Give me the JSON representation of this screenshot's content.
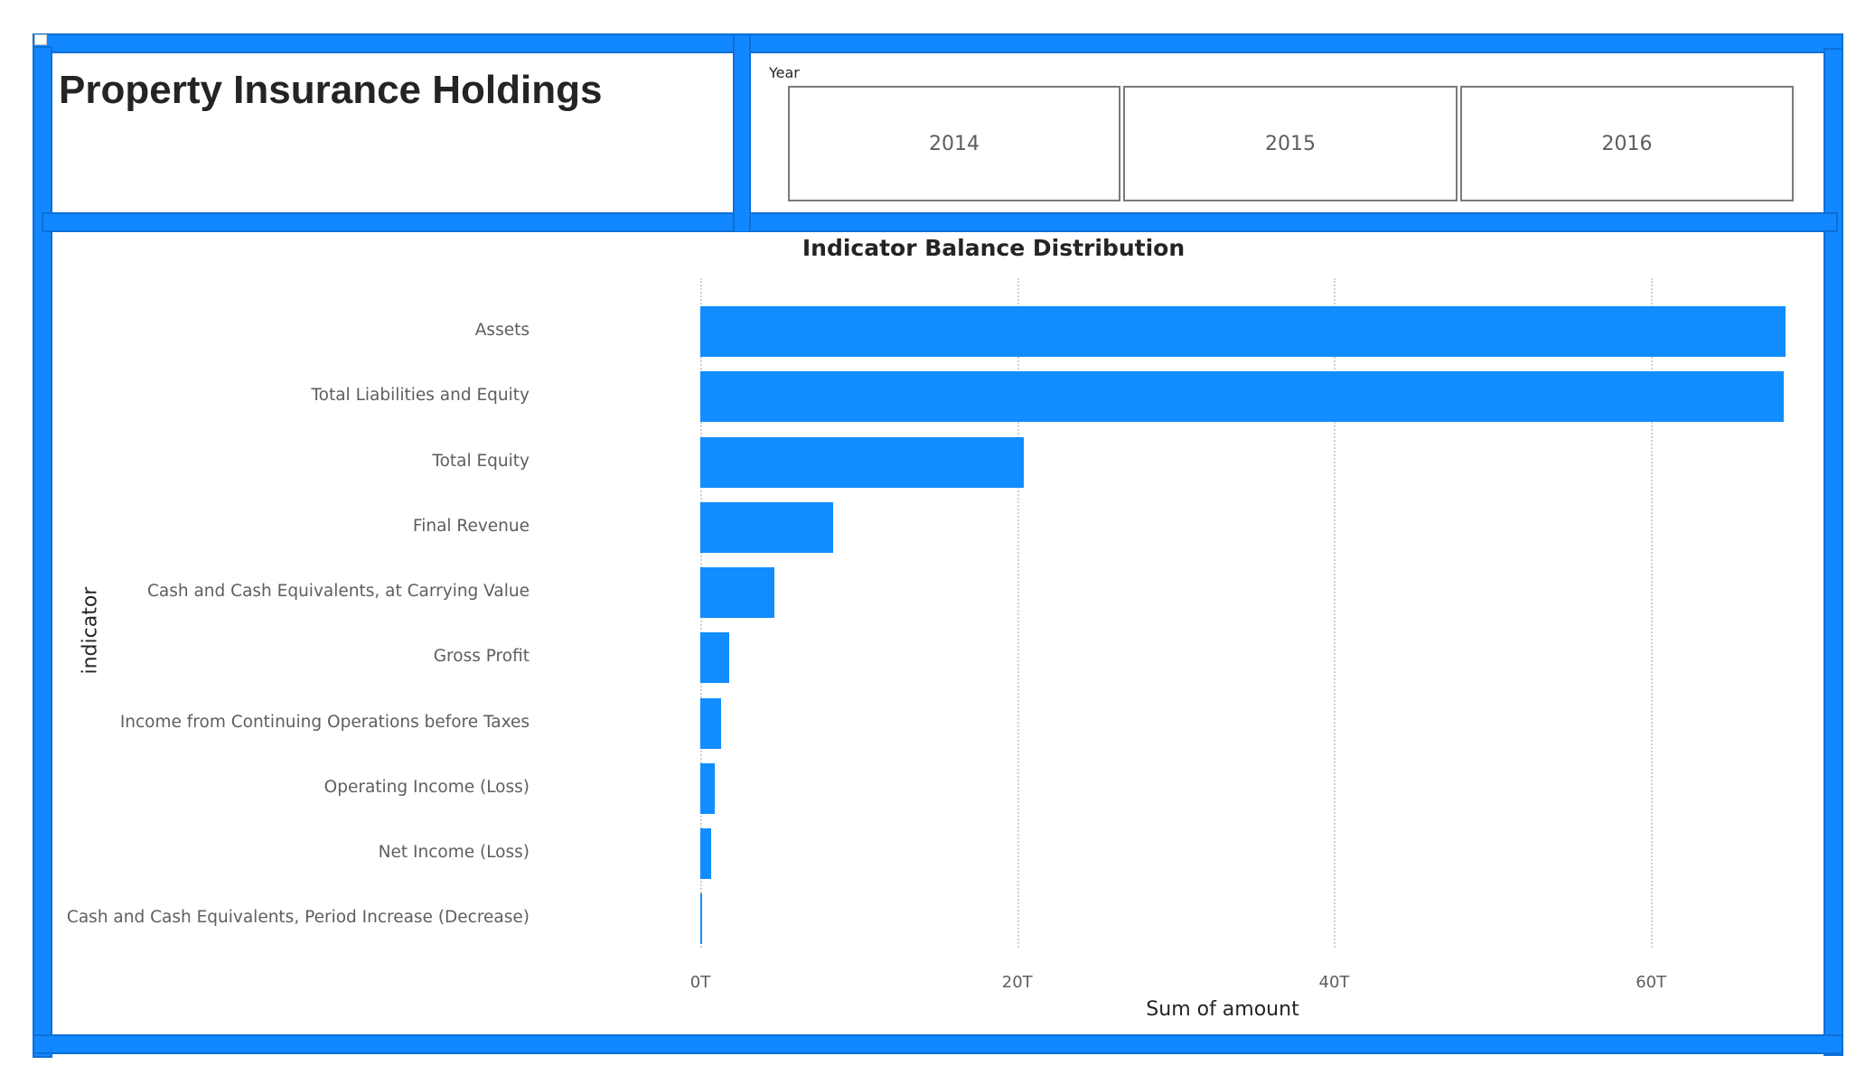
{
  "report": {
    "title": "Property Insurance Holdings",
    "accent_color": "#118dff"
  },
  "year_slicer": {
    "header": "Year",
    "options": [
      "2014",
      "2015",
      "2016"
    ]
  },
  "chart_data": {
    "type": "bar",
    "orientation": "horizontal",
    "title": "Indicator Balance Distribution",
    "xlabel": "Sum of amount",
    "ylabel": "indicator",
    "categories": [
      "Assets",
      "Total Liabilities and Equity",
      "Total Equity",
      "Final Revenue",
      "Cash and Cash Equivalents, at Carrying Value",
      "Gross Profit",
      "Income from Continuing Operations before Taxes",
      "Operating Income (Loss)",
      "Net Income (Loss)",
      "Cash and Cash Equivalents, Period Increase (Decrease)"
    ],
    "values": [
      68.5,
      68.4,
      20.4,
      8.4,
      4.7,
      1.8,
      1.3,
      0.9,
      0.7,
      0.05
    ],
    "value_unit": "T",
    "xlim": [
      0,
      68.6
    ],
    "xticks": [
      0,
      20,
      40,
      60
    ],
    "xtick_labels": [
      "0T",
      "20T",
      "40T",
      "60T"
    ],
    "grid": "vertical dotted",
    "bar_color": "#118dff"
  }
}
